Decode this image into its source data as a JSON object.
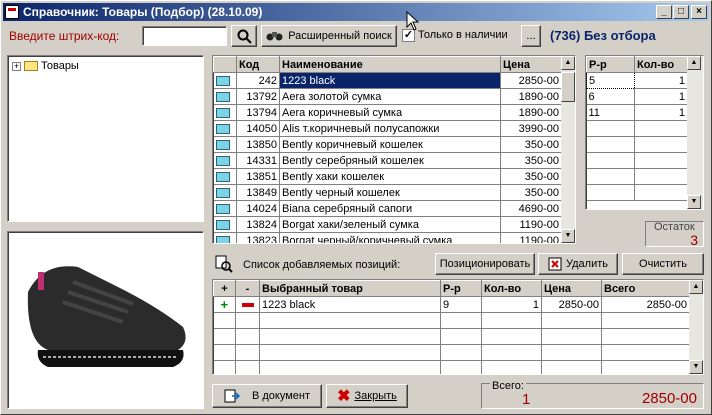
{
  "window": {
    "title": "Справочник: Товары (Подбор) (28.10.09)"
  },
  "toolbar": {
    "barcode_label": "Введите штрих-код:",
    "barcode_value": "",
    "ext_search": "Расширенный поиск",
    "in_stock": "Только в наличии",
    "ellipsis": "...",
    "selection_info": "(736) Без отбора"
  },
  "tree": {
    "root": "Товары"
  },
  "products": {
    "cols": [
      "Код",
      "Наименование",
      "Цена"
    ],
    "rows": [
      [
        "242",
        "1223 black",
        "2850-00"
      ],
      [
        "13792",
        "Aera золотой сумка",
        "1890-00"
      ],
      [
        "13794",
        "Aera коричневый сумка",
        "1890-00"
      ],
      [
        "14050",
        "Alis т.коричневый полусапожки",
        "3990-00"
      ],
      [
        "13850",
        "Bently коричневый кошелек",
        "350-00"
      ],
      [
        "14331",
        "Bently серебряный кошелек",
        "350-00"
      ],
      [
        "13851",
        "Bently хаки кошелек",
        "350-00"
      ],
      [
        "13849",
        "Bently черный кошелек",
        "350-00"
      ],
      [
        "14024",
        "Biana серебряный сапоги",
        "4690-00"
      ],
      [
        "13824",
        "Borgat хаки/зеленый сумка",
        "1190-00"
      ],
      [
        "13823",
        "Borgat черный/коричневый сумка",
        "1190-00"
      ]
    ]
  },
  "sizes": {
    "cols": [
      "Р-р",
      "Кол-во"
    ],
    "rows": [
      [
        "5",
        "1"
      ],
      [
        "6",
        "1"
      ],
      [
        "11",
        "1"
      ]
    ]
  },
  "remain": {
    "label": "Остаток",
    "value": "3"
  },
  "added": {
    "label": "Список добавляемых позиций:",
    "position_btn": "Позиционировать",
    "delete_btn": "Удалить",
    "clear_btn": "Очистить",
    "cols": [
      "+",
      "-",
      "Выбранный товар",
      "Р-р",
      "Кол-во",
      "Цена",
      "Всего"
    ],
    "rows": [
      [
        "1223 black",
        "9",
        "1",
        "2850-00",
        "2850-00"
      ]
    ]
  },
  "footer": {
    "to_doc": "В документ",
    "close": "Закрыть",
    "total_label": "Всего:",
    "total_qty": "1",
    "total_sum": "2850-00"
  },
  "colors": {
    "title_start": "#0a246a",
    "accent_red": "#a00000",
    "selection": "#0a246a"
  }
}
